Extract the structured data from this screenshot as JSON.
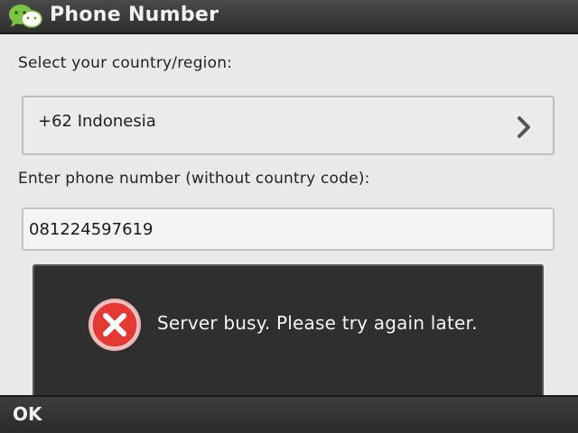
{
  "titlebar": {
    "title": "Phone Number",
    "logo_icon": "wechat-logo-icon",
    "logo_color": "#7cc243"
  },
  "form": {
    "country_label": "Select your country/region:",
    "country_value": "+62  Indonesia",
    "chevron_icon": "chevron-right-icon",
    "phone_label": "Enter phone number (without country code):",
    "phone_value": "081224597619"
  },
  "dialog": {
    "icon": "error-icon",
    "icon_color": "#e53935",
    "message": "Server busy. Please try again later."
  },
  "softkeys": {
    "left_label": "OK"
  }
}
